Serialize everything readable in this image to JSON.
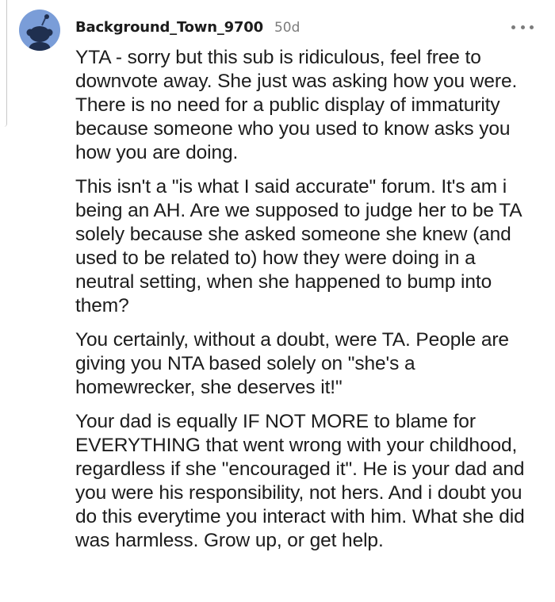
{
  "comment": {
    "username": "Background_Town_9700",
    "age": "50d",
    "avatar_icon": "snoo-avatar-icon",
    "more_icon": "more-options-icon",
    "paragraphs": [
      "YTA - sorry but this sub is ridiculous, feel free to downvote away. She just was asking how you were. There is no need for a public display of immaturity because someone who you used to know asks you how you are doing.",
      "This isn't a \"is what I said accurate\" forum. It's am i being an AH. Are we supposed to judge her to be TA solely because she asked someone she knew (and used to be related to) how they were doing in a neutral setting, when she happened to bump into them?",
      "You certainly, without a doubt, were TA. People are giving you NTA based solely on \"she's a homewrecker, she deserves it!\"",
      "Your dad is equally IF NOT MORE to blame for EVERYTHING that went wrong with your childhood, regardless if she \"encouraged it\". He is your dad and you were his responsibility, not hers. And i doubt you do this everytime you interact with him. What she did was harmless. Grow up, or get help."
    ]
  },
  "colors": {
    "avatar_bg": "#7a9dd8",
    "text": "#1c1c1c",
    "meta": "#7c7c7c"
  }
}
